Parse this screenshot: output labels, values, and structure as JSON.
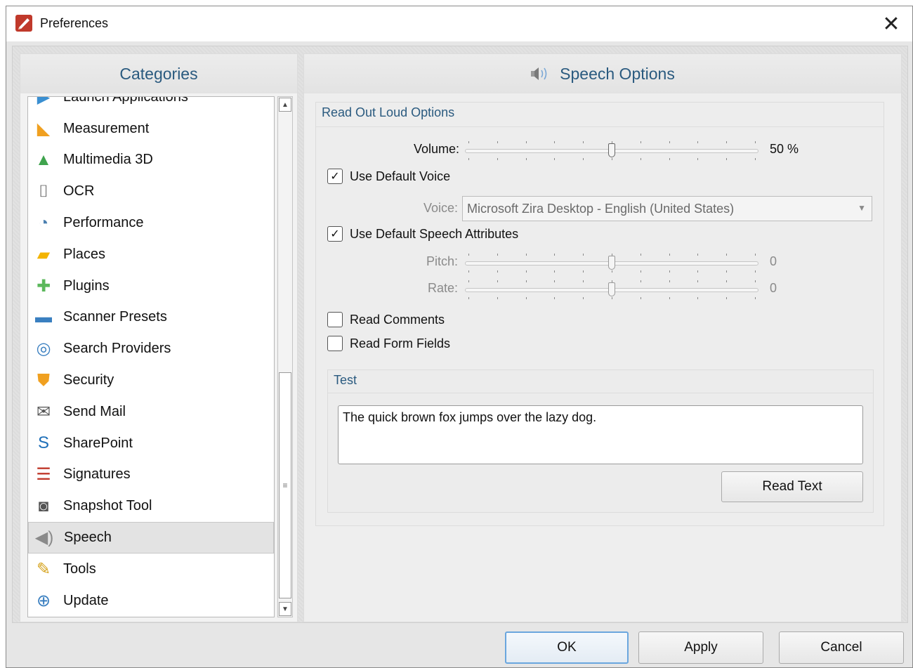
{
  "window": {
    "title": "Preferences",
    "close_label": "✕"
  },
  "colors": {
    "accent": "#2a5a7f",
    "selection": "#e3e3e3",
    "primary_border": "#6aa6de"
  },
  "categories": {
    "header": "Categories",
    "items": [
      {
        "label": "Launch Applications",
        "icon": "launch-applications-icon",
        "glyph": "▶",
        "color": "#3a8fd1"
      },
      {
        "label": "Measurement",
        "icon": "ruler-triangle-icon",
        "glyph": "◣",
        "color": "#f0a020"
      },
      {
        "label": "Multimedia 3D",
        "icon": "shapes-3d-icon",
        "glyph": "▲",
        "color": "#3fa34d"
      },
      {
        "label": "OCR",
        "icon": "ocr-document-icon",
        "glyph": "⌷",
        "color": "#5a5a5a"
      },
      {
        "label": "Performance",
        "icon": "gauge-icon",
        "glyph": "◔",
        "color": "#4a7fb0"
      },
      {
        "label": "Places",
        "icon": "folder-pin-icon",
        "glyph": "▰",
        "color": "#f3b400"
      },
      {
        "label": "Plugins",
        "icon": "puzzle-icon",
        "glyph": "✚",
        "color": "#5cb85c"
      },
      {
        "label": "Scanner Presets",
        "icon": "scanner-icon",
        "glyph": "▬",
        "color": "#3a7fc0"
      },
      {
        "label": "Search Providers",
        "icon": "globe-binoculars-icon",
        "glyph": "◎",
        "color": "#3a7fc0"
      },
      {
        "label": "Security",
        "icon": "shield-icon",
        "glyph": "⛊",
        "color": "#f0a020"
      },
      {
        "label": "Send Mail",
        "icon": "envelope-arrow-icon",
        "glyph": "✉",
        "color": "#555555"
      },
      {
        "label": "SharePoint",
        "icon": "sharepoint-icon",
        "glyph": "S",
        "color": "#1e6fb8"
      },
      {
        "label": "Signatures",
        "icon": "certificate-icon",
        "glyph": "☰",
        "color": "#c0392b"
      },
      {
        "label": "Snapshot Tool",
        "icon": "camera-icon",
        "glyph": "◙",
        "color": "#555555"
      },
      {
        "label": "Speech",
        "icon": "speaker-icon",
        "glyph": "◀)",
        "color": "#8a8a8a"
      },
      {
        "label": "Tools",
        "icon": "tools-icon",
        "glyph": "✎",
        "color": "#d4a017"
      },
      {
        "label": "Update",
        "icon": "globe-update-icon",
        "glyph": "⊕",
        "color": "#3a7fc0"
      }
    ],
    "selected": "Speech"
  },
  "options": {
    "header": "Speech Options",
    "header_icon": "speaker-icon",
    "read_out_loud": {
      "title": "Read Out Loud Options",
      "volume": {
        "label": "Volume:",
        "value": 50,
        "display": "50 %"
      },
      "use_default_voice": {
        "label": "Use Default Voice",
        "checked": true
      },
      "voice": {
        "label": "Voice:",
        "value": "Microsoft Zira Desktop - English (United States)"
      },
      "use_default_attributes": {
        "label": "Use Default Speech Attributes",
        "checked": true
      },
      "pitch": {
        "label": "Pitch:",
        "value": 0,
        "display": "0"
      },
      "rate": {
        "label": "Rate:",
        "value": 0,
        "display": "0"
      },
      "read_comments": {
        "label": "Read Comments",
        "checked": false
      },
      "read_form_fields": {
        "label": "Read Form Fields",
        "checked": false
      }
    },
    "test": {
      "title": "Test",
      "text": "The quick brown fox jumps over the lazy dog.",
      "button": "Read Text"
    }
  },
  "footer": {
    "ok": "OK",
    "apply": "Apply",
    "cancel": "Cancel"
  }
}
